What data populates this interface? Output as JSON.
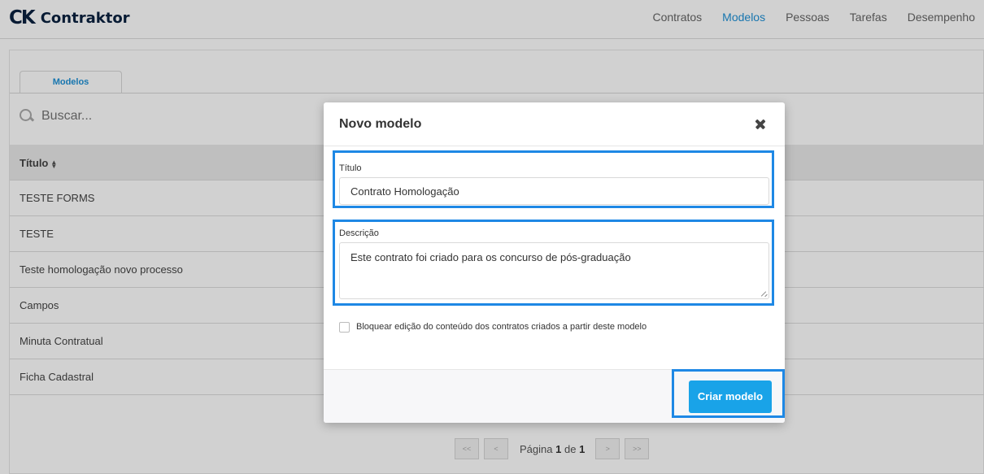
{
  "brand": {
    "mark_c": "C",
    "mark_k": "K",
    "name": "Contraktor"
  },
  "nav": {
    "items": [
      {
        "label": "Contratos",
        "active": false
      },
      {
        "label": "Modelos",
        "active": true
      },
      {
        "label": "Pessoas",
        "active": false
      },
      {
        "label": "Tarefas",
        "active": false
      },
      {
        "label": "Desempenho",
        "active": false
      }
    ]
  },
  "page": {
    "tab_label": "Modelos",
    "search_placeholder": "Buscar...",
    "table": {
      "header": "Título",
      "sort_icon": "▲▼",
      "rows": [
        "TESTE FORMS",
        "TESTE",
        "Teste homologação novo processo",
        "Campos",
        "Minuta Contratual",
        "Ficha Cadastral"
      ]
    },
    "pagination": {
      "first": "<<",
      "prev": "<",
      "next": ">",
      "last": ">>",
      "label": "Página",
      "current": "1",
      "of": "de",
      "total": "1"
    }
  },
  "modal": {
    "title": "Novo modelo",
    "title_field": {
      "label": "Título",
      "value": "Contrato Homologação"
    },
    "description_field": {
      "label": "Descrição",
      "value": "Este contrato foi criado para os concurso de pós-graduação"
    },
    "lock_checkbox": {
      "label": "Bloquear edição do conteúdo dos contratos criados a partir deste modelo",
      "checked": false
    },
    "submit_label": "Criar modelo"
  },
  "colors": {
    "accent": "#1e90d6",
    "button": "#19a3e8",
    "highlight": "#1e88e5",
    "brand": "#0a2240"
  }
}
